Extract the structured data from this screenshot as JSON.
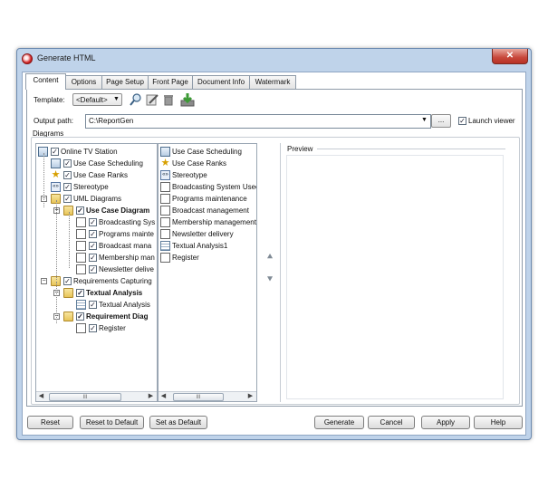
{
  "window": {
    "title": "Generate HTML"
  },
  "tabs": [
    {
      "label": "Content",
      "active": true
    },
    {
      "label": "Options",
      "active": false
    },
    {
      "label": "Page Setup",
      "active": false
    },
    {
      "label": "Front Page",
      "active": false
    },
    {
      "label": "Document Info",
      "active": false
    },
    {
      "label": "Watermark",
      "active": false
    }
  ],
  "template": {
    "label": "Template:",
    "value": "<Default>"
  },
  "output": {
    "label": "Output path:",
    "value": "C:\\ReportGen",
    "browse_label": "...",
    "launch_viewer_label": "Launch viewer",
    "launch_viewer_checked": true
  },
  "diagrams_group": {
    "label": "Diagrams"
  },
  "tree": [
    {
      "label": "Online TV Station",
      "checked": true,
      "bold": false,
      "icon": "project-icon"
    },
    {
      "label": "Use Case Scheduling",
      "checked": true,
      "bold": false,
      "icon": "diagram-icon"
    },
    {
      "label": "Use Case Ranks",
      "checked": true,
      "bold": false,
      "icon": "star-icon"
    },
    {
      "label": "Stereotype",
      "checked": true,
      "bold": false,
      "icon": "stereotype-icon"
    },
    {
      "label": "UML Diagrams",
      "checked": true,
      "bold": false,
      "icon": "folder-icon"
    },
    {
      "label": "Use Case Diagram",
      "checked": true,
      "bold": true,
      "icon": "folder-icon"
    },
    {
      "label": "Broadcasting Sys",
      "checked": true,
      "bold": false,
      "icon": "use-case-diagram-icon"
    },
    {
      "label": "Programs mainte",
      "checked": true,
      "bold": false,
      "icon": "use-case-diagram-icon"
    },
    {
      "label": "Broadcast mana",
      "checked": true,
      "bold": false,
      "icon": "use-case-diagram-icon"
    },
    {
      "label": "Membership man",
      "checked": true,
      "bold": false,
      "icon": "use-case-diagram-icon"
    },
    {
      "label": "Newsletter delive",
      "checked": true,
      "bold": false,
      "icon": "use-case-diagram-icon"
    },
    {
      "label": "Requirements Capturing",
      "checked": true,
      "bold": false,
      "icon": "folder-icon"
    },
    {
      "label": "Textual Analysis",
      "checked": true,
      "bold": true,
      "icon": "folder-icon"
    },
    {
      "label": "Textual Analysis",
      "checked": true,
      "bold": false,
      "icon": "textual-analysis-icon"
    },
    {
      "label": "Requirement Diag",
      "checked": true,
      "bold": true,
      "icon": "folder-icon"
    },
    {
      "label": "Register",
      "checked": true,
      "bold": false,
      "icon": "requirement-diagram-icon"
    }
  ],
  "selected_list": [
    {
      "label": "Use Case Scheduling",
      "icon": "diagram-icon"
    },
    {
      "label": "Use Case Ranks",
      "icon": "star-icon"
    },
    {
      "label": "Stereotype",
      "icon": "stereotype-icon"
    },
    {
      "label": "Broadcasting System Useca",
      "icon": "use-case-diagram-icon"
    },
    {
      "label": "Programs maintenance",
      "icon": "use-case-diagram-icon"
    },
    {
      "label": "Broadcast management",
      "icon": "use-case-diagram-icon"
    },
    {
      "label": "Membership management",
      "icon": "use-case-diagram-icon"
    },
    {
      "label": "Newsletter delivery",
      "icon": "use-case-diagram-icon"
    },
    {
      "label": "Textual Analysis1",
      "icon": "textual-analysis-icon"
    },
    {
      "label": "Register",
      "icon": "requirement-diagram-icon"
    }
  ],
  "preview": {
    "label": "Preview"
  },
  "scroll_thumb_glyph": "III",
  "buttons": {
    "reset": "Reset",
    "reset_default": "Reset to Default",
    "set_default": "Set as Default",
    "generate": "Generate",
    "cancel": "Cancel",
    "apply": "Apply",
    "help": "Help"
  },
  "colors": {
    "title_bar": "#bfd3ea",
    "close_button": "#c7473a",
    "accent_green": "#3c9a35"
  }
}
